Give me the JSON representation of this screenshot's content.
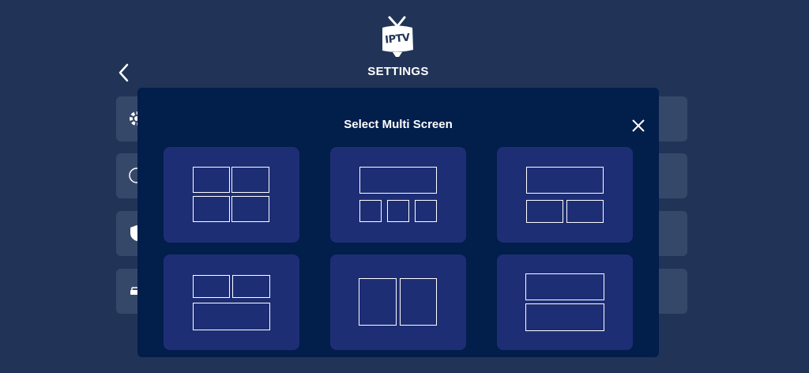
{
  "logo": {
    "text": "IPTV",
    "icon": "tv-antenna-icon"
  },
  "header": {
    "title": "SETTINGS",
    "back_icon": "chevron-left-icon"
  },
  "background_rows": [
    {
      "icon": "gear-icon"
    },
    {
      "icon": "info-icon"
    },
    {
      "icon": "shield-icon"
    },
    {
      "icon": "car-icon"
    }
  ],
  "modal": {
    "title": "Select Multi Screen",
    "close_icon": "close-icon",
    "layouts": [
      {
        "id": "grid-2x2"
      },
      {
        "id": "one-top-three-bottom"
      },
      {
        "id": "one-top-two-bottom"
      },
      {
        "id": "two-top-one-bottom"
      },
      {
        "id": "two-side-by-side"
      },
      {
        "id": "two-stacked"
      }
    ]
  },
  "colors": {
    "background": "#213457",
    "modal": "#021e4b",
    "card": "#1e2e75",
    "row": "#36486a"
  }
}
